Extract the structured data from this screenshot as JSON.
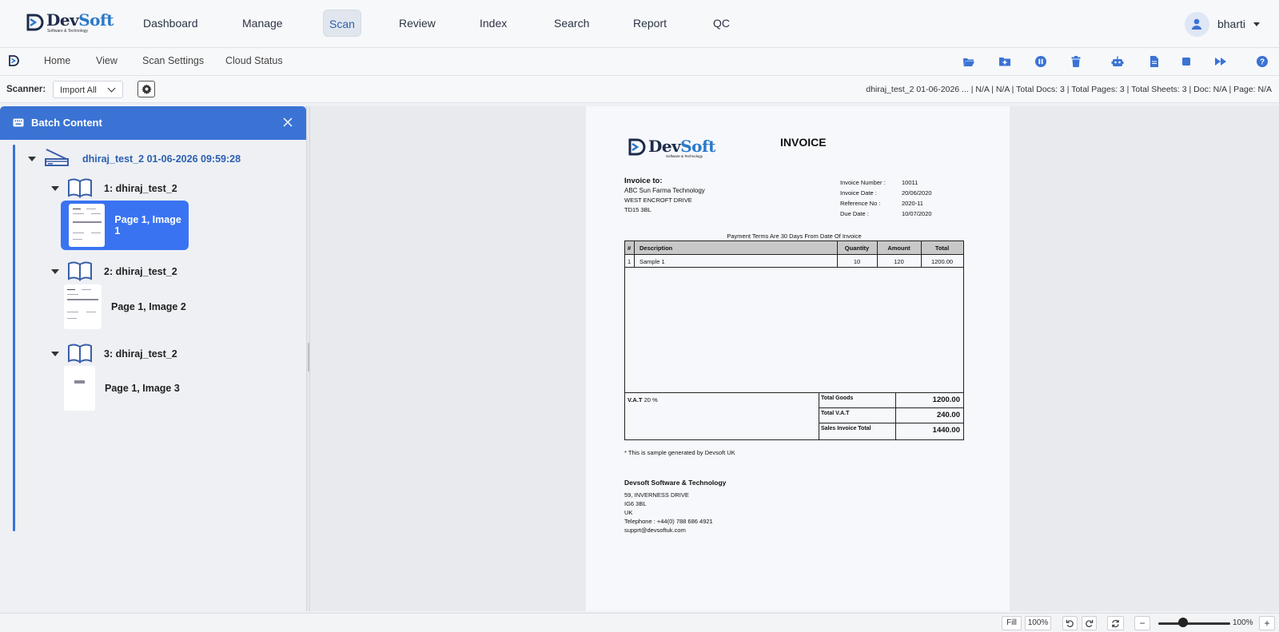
{
  "app": {
    "logo_main": "Dev",
    "logo_accent": "Soft",
    "logo_tagline": "Software & Technology"
  },
  "nav": {
    "items": [
      "Dashboard",
      "Manage",
      "Scan",
      "Review",
      "Index",
      "Search",
      "Report",
      "QC"
    ],
    "active": "Scan"
  },
  "user": {
    "name": "bharti"
  },
  "menubar": {
    "items": [
      "Home",
      "View",
      "Scan Settings",
      "Cloud Status"
    ],
    "toolbar_icons": [
      "folder-open-icon",
      "folder-plus-icon",
      "pause-icon",
      "trash-icon",
      "robot-icon",
      "file-icon",
      "stop-icon",
      "fast-forward-icon",
      "help-icon"
    ]
  },
  "scanner": {
    "label": "Scanner:",
    "selected": "Import All",
    "status": "dhiraj_test_2 01-06-2026 ...  |  N/A  |  N/A  | Total Docs:  3  | Total Pages:  3  | Total Sheets:  3  | Doc:  N/A  | Page:  N/A"
  },
  "batch_panel": {
    "title": "Batch Content",
    "batch": "dhiraj_test_2 01-06-2026 09:59:28",
    "documents": [
      {
        "name": "1: dhiraj_test_2",
        "page": "Page 1, Image 1"
      },
      {
        "name": "2: dhiraj_test_2",
        "page": "Page 1, Image 2"
      },
      {
        "name": "3: dhiraj_test_2",
        "page": "Page 1, Image 3"
      }
    ]
  },
  "invoice": {
    "logo_main": "Dev",
    "logo_accent": "Soft",
    "logo_tagline": "Software & Technology",
    "title": "INVOICE",
    "to_label": "Invoice to:",
    "to_lines": [
      "ABC Sun Farma Technology",
      "WEST ENCROFT DRIVE",
      "TD15 3BL"
    ],
    "meta": [
      {
        "k": "Invoice Number :",
        "v": "10011"
      },
      {
        "k": "Invoice Date :",
        "v": "20/06/2020"
      },
      {
        "k": "Reference No :",
        "v": "2020-11"
      },
      {
        "k": "Due Date :",
        "v": "10/07/2020"
      }
    ],
    "terms": "Payment Terms Are 30 Days From Date Of Invoice",
    "headers": [
      "#",
      "Description",
      "Quantity",
      "Amount",
      "Total"
    ],
    "row": [
      "1",
      "Sample 1",
      "10",
      "120",
      "1200.00"
    ],
    "vat_label": "V.A.T",
    "vat_rate": "20 %",
    "totals": [
      {
        "k": "Total Goods",
        "v": "1200.00"
      },
      {
        "k": "Total V.A.T",
        "v": "240.00"
      },
      {
        "k": "Sales Invoice Total",
        "v": "1440.00"
      }
    ],
    "note": "* This is sample generated by Devsoft UK",
    "company": "Devsoft Software & Technology",
    "address": [
      "59, INVERNESS DRIVE",
      "IG6 3BL",
      "UK",
      "Telephone : +44(0) 788 686 4921",
      "supprt@devsoftuk.com"
    ]
  },
  "bottom": {
    "fill": "Fill",
    "zoom": "100%",
    "zoom_right": "100%",
    "minus": "−",
    "plus": "+"
  }
}
